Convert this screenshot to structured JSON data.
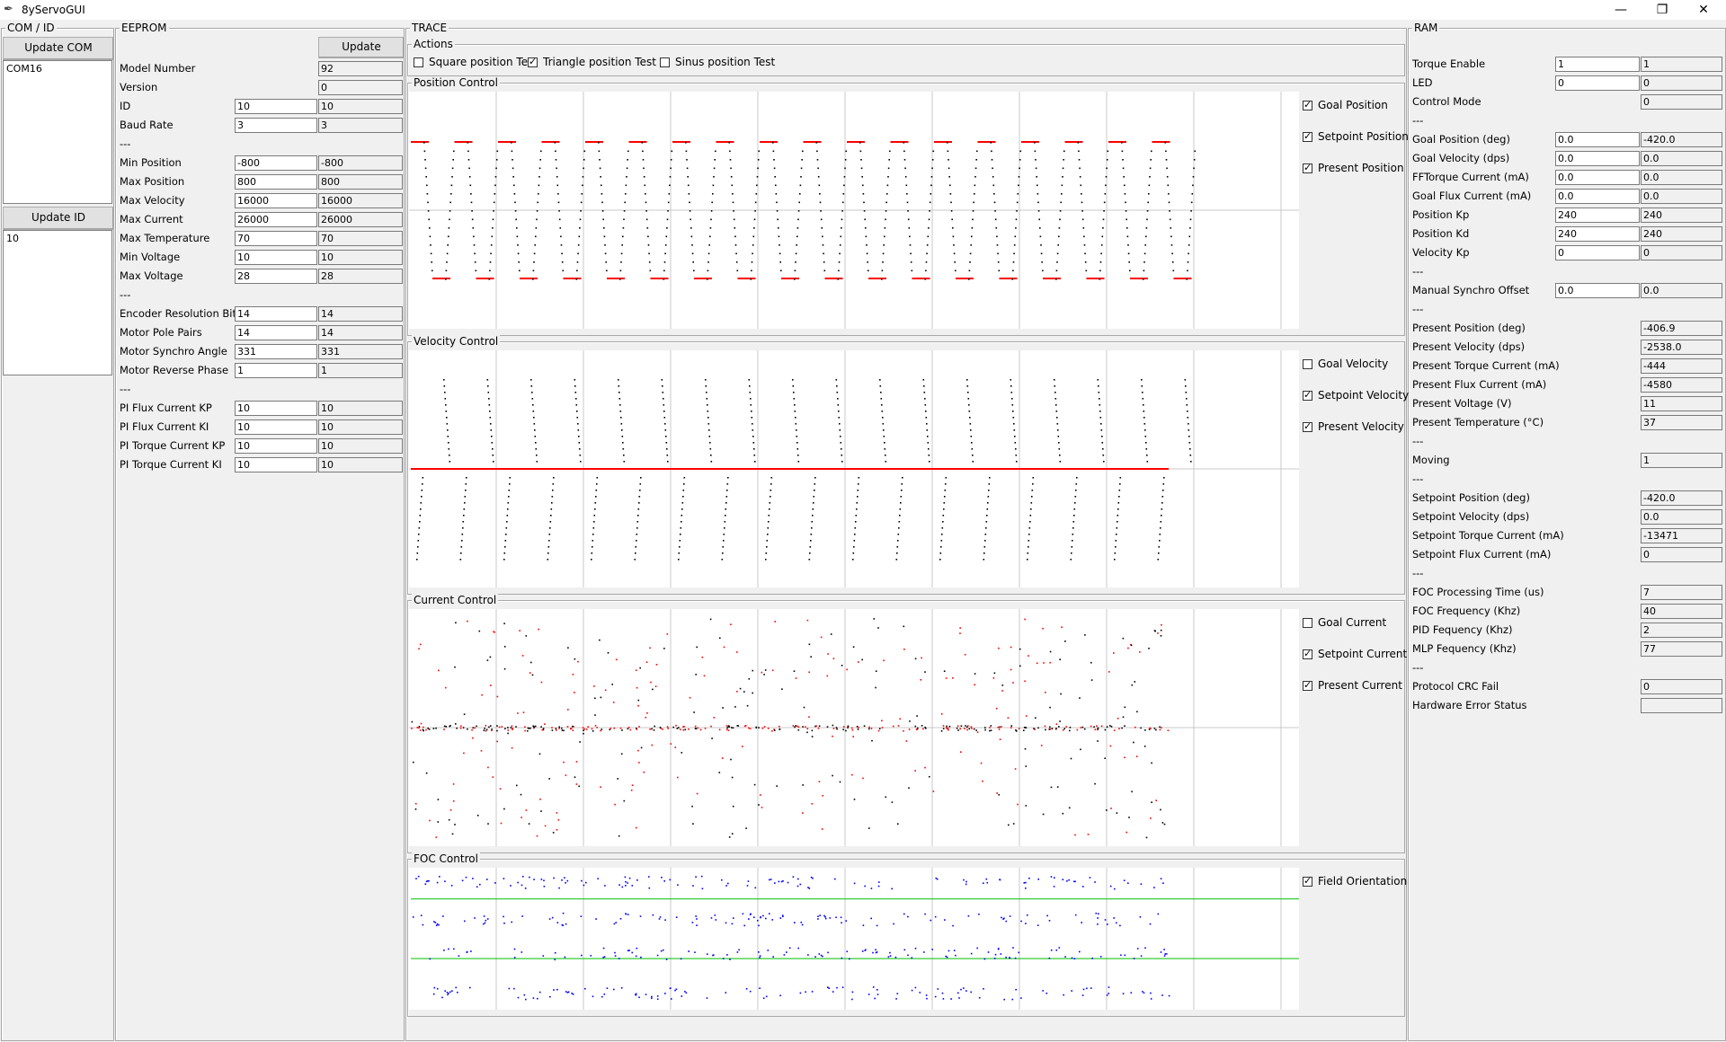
{
  "window": {
    "title": "8yServoGUI"
  },
  "com_id": {
    "title": "COM / ID",
    "update_com_label": "Update COM",
    "com_list": [
      "COM16"
    ],
    "update_id_label": "Update ID",
    "id_list": [
      "10"
    ]
  },
  "eeprom": {
    "title": "EEPROM",
    "update_label": "Update",
    "rows": [
      {
        "label": "Model Number",
        "value": null,
        "read": "92"
      },
      {
        "label": "Version",
        "value": null,
        "read": "0"
      },
      {
        "label": "ID",
        "value": "10",
        "read": "10"
      },
      {
        "label": "Baud Rate",
        "value": "3",
        "read": "3"
      },
      {
        "label": "---",
        "sep": true
      },
      {
        "label": "Min Position",
        "value": "-800",
        "read": "-800"
      },
      {
        "label": "Max Position",
        "value": "800",
        "read": "800"
      },
      {
        "label": "Max Velocity",
        "value": "16000",
        "read": "16000"
      },
      {
        "label": "Max Current",
        "value": "26000",
        "read": "26000"
      },
      {
        "label": "Max Temperature",
        "value": "70",
        "read": "70"
      },
      {
        "label": "Min Voltage",
        "value": "10",
        "read": "10"
      },
      {
        "label": "Max Voltage",
        "value": "28",
        "read": "28"
      },
      {
        "label": "---",
        "sep": true
      },
      {
        "label": "Encoder Resolution Bits",
        "value": "14",
        "read": "14"
      },
      {
        "label": "Motor Pole Pairs",
        "value": "14",
        "read": "14"
      },
      {
        "label": "Motor Synchro Angle",
        "value": "331",
        "read": "331"
      },
      {
        "label": "Motor Reverse Phase",
        "value": "1",
        "read": "1"
      },
      {
        "label": "---",
        "sep": true
      },
      {
        "label": "PI Flux Current KP",
        "value": "10",
        "read": "10"
      },
      {
        "label": "PI Flux Current KI",
        "value": "10",
        "read": "10"
      },
      {
        "label": "PI Torque Current KP",
        "value": "10",
        "read": "10"
      },
      {
        "label": "PI Torque Current KI",
        "value": "10",
        "read": "10"
      }
    ]
  },
  "trace": {
    "title": "TRACE",
    "actions_title": "Actions",
    "actions": [
      {
        "label": "Square position Test",
        "checked": false
      },
      {
        "label": "Triangle position Test",
        "checked": true
      },
      {
        "label": "Sinus position Test",
        "checked": false
      }
    ],
    "plots": [
      {
        "title": "Position Control",
        "checks": [
          {
            "label": "Goal Position",
            "checked": true
          },
          {
            "label": "Setpoint Position",
            "checked": true
          },
          {
            "label": "Present Position",
            "checked": true
          }
        ]
      },
      {
        "title": "Velocity Control",
        "checks": [
          {
            "label": "Goal Velocity",
            "checked": false
          },
          {
            "label": "Setpoint Velocity",
            "checked": true
          },
          {
            "label": "Present Velocity",
            "checked": true
          }
        ]
      },
      {
        "title": "Current Control",
        "checks": [
          {
            "label": "Goal Current",
            "checked": false
          },
          {
            "label": "Setpoint Current",
            "checked": true
          },
          {
            "label": "Present Current",
            "checked": true
          }
        ]
      },
      {
        "title": "FOC Control",
        "checks": [
          {
            "label": "Field Orientation",
            "checked": true
          }
        ]
      }
    ],
    "colors": {
      "setpoint": "#ff0000",
      "present": "#000000",
      "foc_points": "#0000ff",
      "foc_line": "#00c000",
      "grid": "#c8c8c8"
    }
  },
  "ram": {
    "title": "RAM",
    "rows": [
      {
        "label": "Torque Enable",
        "value": "1",
        "read": "1"
      },
      {
        "label": "LED",
        "value": "0",
        "read": "0"
      },
      {
        "label": "Control Mode",
        "value": null,
        "read": "0"
      },
      {
        "label": "---",
        "sep": true
      },
      {
        "label": "Goal Position (deg)",
        "value": "0.0",
        "read": "-420.0"
      },
      {
        "label": "Goal Velocity (dps)",
        "value": "0.0",
        "read": "0.0"
      },
      {
        "label": "FFTorque Current (mA)",
        "value": "0.0",
        "read": "0.0"
      },
      {
        "label": "Goal Flux Current (mA)",
        "value": "0.0",
        "read": "0.0"
      },
      {
        "label": "Position Kp",
        "value": "240",
        "read": "240"
      },
      {
        "label": "Position Kd",
        "value": "240",
        "read": "240"
      },
      {
        "label": "Velocity Kp",
        "value": "0",
        "read": "0"
      },
      {
        "label": "---",
        "sep": true
      },
      {
        "label": "Manual Synchro Offset",
        "value": "0.0",
        "read": "0.0"
      },
      {
        "label": "---",
        "sep": true
      },
      {
        "label": "Present Position (deg)",
        "value": null,
        "read": "-406.9"
      },
      {
        "label": "Present Velocity (dps)",
        "value": null,
        "read": "-2538.0"
      },
      {
        "label": "Present Torque Current (mA)",
        "value": null,
        "read": "-444"
      },
      {
        "label": "Present Flux Current (mA)",
        "value": null,
        "read": "-4580"
      },
      {
        "label": "Present Voltage (V)",
        "value": null,
        "read": "11"
      },
      {
        "label": "Present Temperature (°C)",
        "value": null,
        "read": "37"
      },
      {
        "label": "---",
        "sep": true
      },
      {
        "label": "Moving",
        "value": null,
        "read": "1"
      },
      {
        "label": "---",
        "sep": true
      },
      {
        "label": "Setpoint Position (deg)",
        "value": null,
        "read": "-420.0"
      },
      {
        "label": "Setpoint Velocity (dps)",
        "value": null,
        "read": "0.0"
      },
      {
        "label": "Setpoint Torque Current (mA)",
        "value": null,
        "read": "-13471"
      },
      {
        "label": "Setpoint Flux Current (mA)",
        "value": null,
        "read": "0"
      },
      {
        "label": "---",
        "sep": true
      },
      {
        "label": "FOC Processing Time (us)",
        "value": null,
        "read": "7"
      },
      {
        "label": "FOC Frequency (Khz)",
        "value": null,
        "read": "40"
      },
      {
        "label": "PID Fequency (Khz)",
        "value": null,
        "read": "2"
      },
      {
        "label": "MLP Fequency (Khz)",
        "value": null,
        "read": "77"
      },
      {
        "label": "---",
        "sep": true
      },
      {
        "label": "Protocol CRC Fail",
        "value": null,
        "read": "0"
      },
      {
        "label": "Hardware Error Status",
        "value": null,
        "read": ""
      }
    ]
  }
}
